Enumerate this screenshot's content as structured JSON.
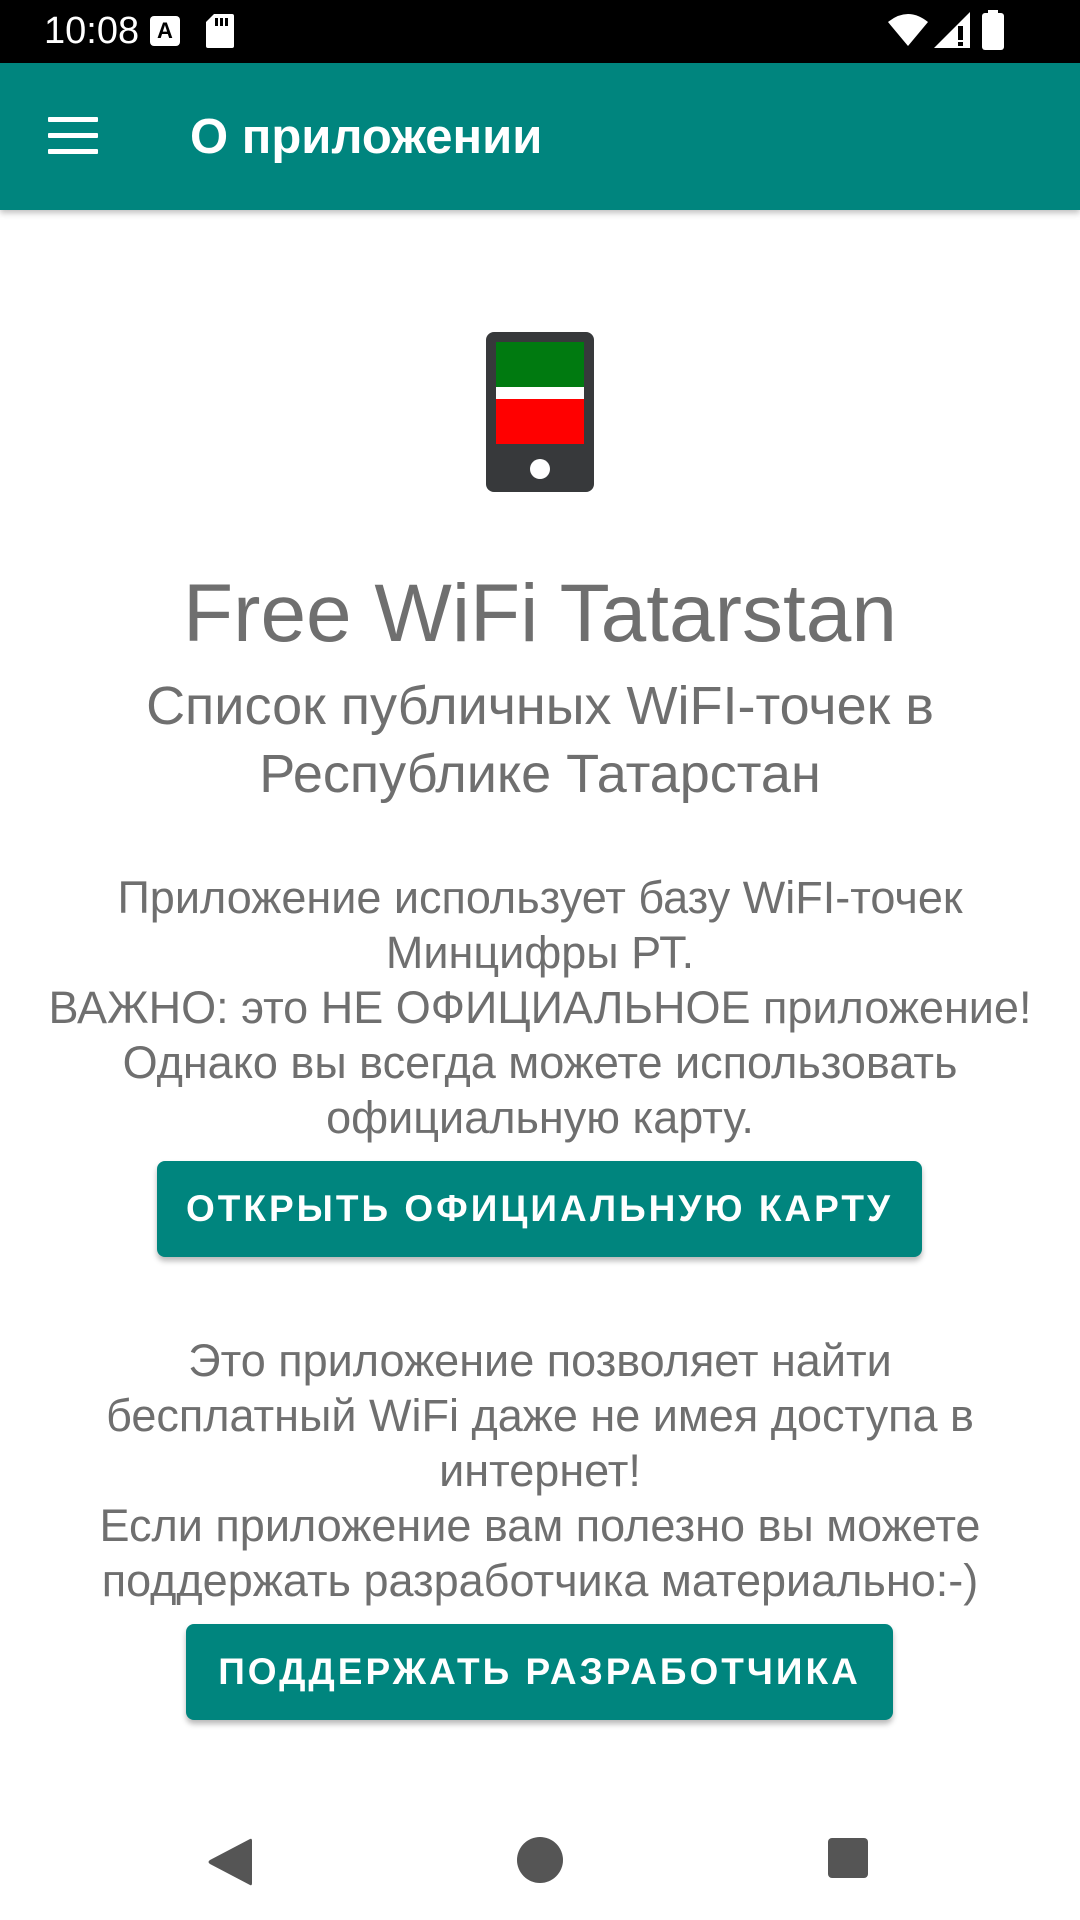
{
  "status_bar": {
    "time": "10:08",
    "icon_a": "A",
    "icons": [
      "a-notification-icon",
      "sd-card-icon",
      "wifi-icon",
      "signal-icon",
      "battery-icon"
    ]
  },
  "app_bar": {
    "menu_icon": "hamburger-menu-icon",
    "title": "О приложении",
    "color": "#00857e"
  },
  "content": {
    "logo_icon": "phone-tatarstan-flag-icon",
    "app_name": "Free WiFi Tatarstan",
    "subtitle": "Список публичных WiFI-точек в Республике Татарстан",
    "paragraph1": {
      "line1": "Приложение использует базу WiFI-точек",
      "line2": "Минцифры РТ.",
      "line3": "ВАЖНО: это НЕ ОФИЦИАЛЬНОЕ приложение!",
      "line4": "Однако вы всегда можете использовать",
      "line5": "официальную карту."
    },
    "open_map_button": "ОТКРЫТЬ ОФИЦИАЛЬНУЮ КАРТУ",
    "paragraph2": {
      "line1": "Это приложение позволяет найти",
      "line2": "бесплатный WiFi даже не имея доступа в",
      "line3": "интернет!",
      "line4": "Если приложение вам полезно вы можете",
      "line5": "поддержать разработчика материально:-)"
    },
    "donate_button": "ПОДДЕРЖАТЬ РАЗРАБОТЧИКА"
  },
  "nav_bar": {
    "icons": [
      "back-icon",
      "home-icon",
      "recents-icon"
    ]
  }
}
